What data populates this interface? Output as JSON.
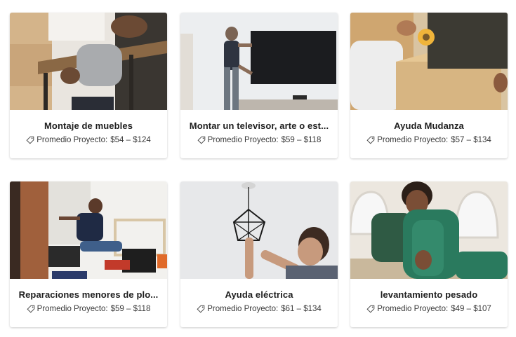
{
  "cards": [
    {
      "title": "Montaje de muebles",
      "price_label": "Promedio Proyecto:",
      "price_range": "$54 – $124",
      "image": "person-assembling-furniture"
    },
    {
      "title": "Montar un televisor, arte o est...",
      "price_label": "Promedio Proyecto:",
      "price_range": "$59 – $118",
      "image": "person-mounting-tv"
    },
    {
      "title": "Ayuda Mudanza",
      "price_label": "Promedio Proyecto:",
      "price_range": "$57 – $134",
      "image": "taping-moving-box"
    },
    {
      "title": "Reparaciones menores de plo...",
      "price_label": "Promedio Proyecto:",
      "price_range": "$59 – $118",
      "image": "person-fixing-sink-pipes"
    },
    {
      "title": "Ayuda eléctrica",
      "price_label": "Promedio Proyecto:",
      "price_range": "$61 – $134",
      "image": "person-installing-light-fixture"
    },
    {
      "title": "levantamiento pesado",
      "price_label": "Promedio Proyecto:",
      "price_range": "$49 – $107",
      "image": "person-carrying-armchair"
    }
  ],
  "icons": {
    "price": "price-tag-icon"
  }
}
